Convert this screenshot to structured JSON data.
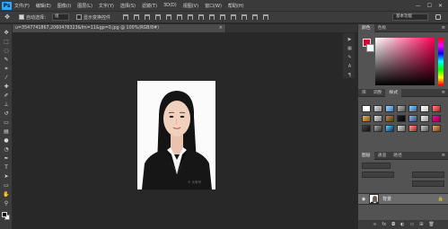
{
  "app": {
    "logo": "Ps"
  },
  "menu": [
    "文件(F)",
    "编辑(E)",
    "图像(I)",
    "图层(L)",
    "文字(Y)",
    "选择(S)",
    "滤镜(T)",
    "3D(D)",
    "视图(V)",
    "窗口(W)",
    "帮助(H)"
  ],
  "window_controls": [
    "—",
    "☐",
    "✕"
  ],
  "options": {
    "auto_select_label": "自动选择：",
    "layer_select": "组",
    "show_transform_label": "显示变换控件",
    "workspace": "基本功能"
  },
  "document": {
    "tab_title": "u=3547741867,2060478323&fm=11&gp=0.jpg @ 100%(RGB/8#)",
    "close": "×",
    "watermark": "© 头条号"
  },
  "panels": {
    "color_tabs": [
      "颜色",
      "色板"
    ],
    "style_tabs": [
      "库",
      "调整",
      "样式"
    ],
    "layer_tabs": [
      "图层",
      "通道",
      "路径"
    ],
    "menu_icon": "≡",
    "foreground_color": "#c8102e",
    "background_color": "#ffffff"
  },
  "layers": [
    {
      "name": "背景",
      "visible": true,
      "locked": true
    }
  ],
  "tools": [
    "move-icon",
    "marquee-icon",
    "lasso-icon",
    "quick-select-icon",
    "crop-icon",
    "eyedropper-icon",
    "healing-icon",
    "brush-icon",
    "stamp-icon",
    "history-brush-icon",
    "eraser-icon",
    "gradient-icon",
    "blur-icon",
    "dodge-icon",
    "pen-icon",
    "type-icon",
    "path-select-icon",
    "shape-icon",
    "hand-icon",
    "zoom-icon"
  ],
  "colors": {
    "ui_bg": "#282828",
    "panel_bg": "#535353",
    "accent": "#31a8ff"
  }
}
